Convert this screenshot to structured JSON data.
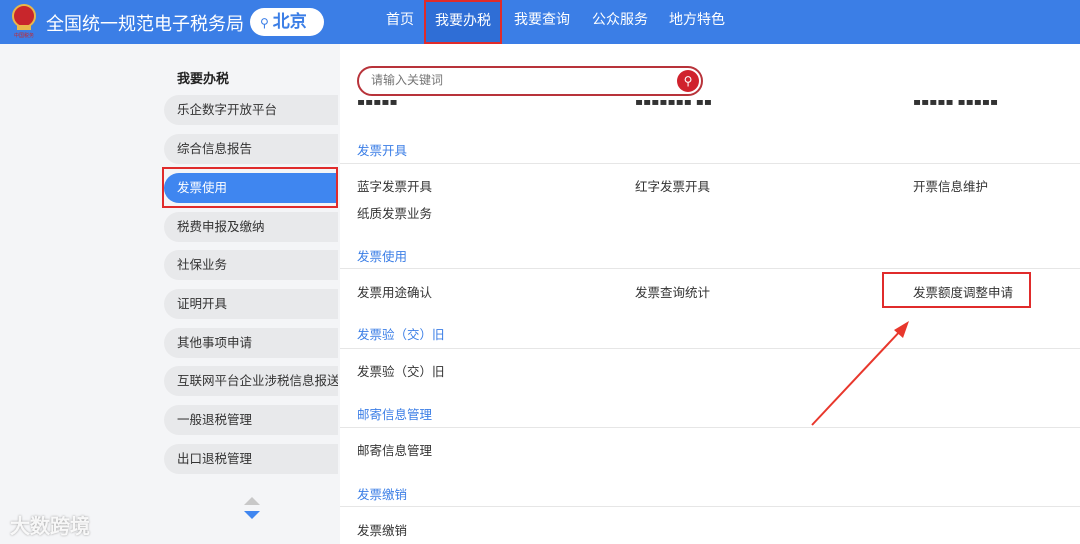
{
  "header": {
    "title": "全国统一规范电子税务局",
    "city": "北京",
    "nav": [
      "首页",
      "我要办税",
      "我要查询",
      "公众服务",
      "地方特色"
    ],
    "active_nav": "我要办税"
  },
  "sidebar": {
    "title": "我要办税",
    "items": [
      "乐企数字开放平台",
      "综合信息报告",
      "发票使用",
      "税费申报及缴纳",
      "社保业务",
      "证明开具",
      "其他事项申请",
      "互联网平台企业涉税信息报送",
      "一般退税管理",
      "出口退税管理"
    ],
    "active": "发票使用"
  },
  "search": {
    "placeholder": "请输入关键词"
  },
  "sections": [
    {
      "title": "发票开具",
      "links": [
        "蓝字发票开具",
        "红字发票开具",
        "开票信息维护",
        "纸质发票业务"
      ]
    },
    {
      "title": "发票使用",
      "links": [
        "发票用途确认",
        "发票查询统计",
        "发票额度调整申请"
      ]
    },
    {
      "title": "发票验（交）旧",
      "links": [
        "发票验（交）旧"
      ]
    },
    {
      "title": "邮寄信息管理",
      "links": [
        "邮寄信息管理"
      ]
    },
    {
      "title": "发票缴销",
      "links": [
        "发票缴销"
      ]
    }
  ],
  "watermark": "大数跨境",
  "colors": {
    "brand": "#3b7ee6",
    "highlight": "#e02b2b",
    "search": "#d0222d"
  }
}
